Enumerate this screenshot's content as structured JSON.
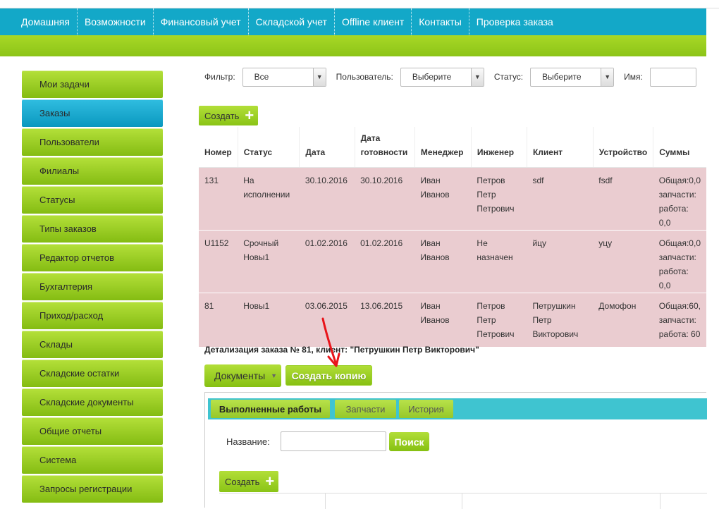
{
  "nav": {
    "items": [
      "Домашняя",
      "Возможности",
      "Финансовый учет",
      "Складской учет",
      "Offline клиент",
      "Контакты",
      "Проверка заказа"
    ]
  },
  "sidebar": {
    "items": [
      "Мои задачи",
      "Заказы",
      "Пользователи",
      "Филиалы",
      "Статусы",
      "Типы заказов",
      "Редактор отчетов",
      "Бухгалтерия",
      "Приход/расход",
      "Склады",
      "Складские остатки",
      "Складские документы",
      "Общие отчеты",
      "Система",
      "Запросы регистрации"
    ],
    "active": "Заказы"
  },
  "filters": {
    "filter_label": "Фильтр:",
    "filter_value": "Все",
    "user_label": "Пользователь:",
    "user_value": "Выберите",
    "status_label": "Статус:",
    "status_value": "Выберите",
    "name_label": "Имя:",
    "name_value": ""
  },
  "create_label": "Создать",
  "orders": {
    "headers": [
      "Номер",
      "Статус",
      "Дата",
      "Дата готовности",
      "Менеджер",
      "Инженер",
      "Клиент",
      "Устройство",
      "Суммы"
    ],
    "rows": [
      [
        "131",
        "На исполнении",
        "30.10.2016",
        "30.10.2016",
        "Иван Иванов",
        "Петров Петр Петрович",
        "sdf",
        "fsdf",
        "Общая:0,0 запчасти: работа: 0,0"
      ],
      [
        "U1152",
        "Срочный Новы1",
        "01.02.2016",
        "01.02.2016",
        "Иван Иванов",
        "Не назначен",
        "йцу",
        "уцу",
        "Общая:0,0 запчасти: работа: 0,0"
      ],
      [
        "81",
        "Новы1",
        "03.06.2015",
        "13.06.2015",
        "Иван Иванов",
        "Петров Петр Петрович",
        "Петрушкин Петр Викторович",
        "Домофон",
        "Общая:60, запчасти: работа: 60"
      ]
    ]
  },
  "detail": {
    "title": "Детализация заказа № 81, клиент: \"Петрушкин Петр Викторович\"",
    "documents_label": "Документы",
    "copy_label": "Создать копию",
    "tabs": [
      "Выполненные работы",
      "Запчасти",
      "История"
    ],
    "search_label": "Название:",
    "search_value": "",
    "search_button": "Поиск",
    "create_label": "Создать"
  },
  "colors": {
    "nav_bg": "#13a8c8",
    "green": "#9ccf22",
    "row_bg": "#eaccd0",
    "annotation_arrow": "#e8141a"
  }
}
